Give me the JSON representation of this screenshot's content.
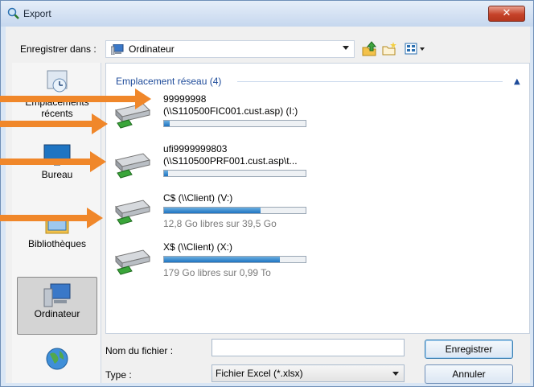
{
  "window": {
    "title": "Export",
    "close_label": "✕"
  },
  "toolbar": {
    "save_in_label": "Enregistrer dans :",
    "location_value": "Ordinateur",
    "buttons": [
      "up-folder-icon",
      "new-folder-icon",
      "view-menu-icon"
    ]
  },
  "places": [
    {
      "label": "Emplacements récents",
      "icon": "recent-places-icon"
    },
    {
      "label": "Bureau",
      "icon": "desktop-icon"
    },
    {
      "label": "Bibliothèques",
      "icon": "libraries-icon"
    },
    {
      "label": "Ordinateur",
      "icon": "computer-icon",
      "selected": true
    },
    {
      "label": "",
      "icon": "network-icon"
    }
  ],
  "file_list": {
    "group_header": "Emplacement réseau (4)",
    "drives": [
      {
        "name": "99999998",
        "path": "(\\\\S110500FIC001.cust.asp) (I:)",
        "used_fraction": 0.04,
        "free_text": ""
      },
      {
        "name": "ufi9999999803",
        "path": "(\\\\S110500PRF001.cust.asp\\t...",
        "used_fraction": 0.03,
        "free_text": ""
      },
      {
        "name": "C$ (\\\\Client) (V:)",
        "path": "",
        "used_fraction": 0.68,
        "free_text": "12,8 Go libres sur 39,5 Go"
      },
      {
        "name": "X$ (\\\\Client) (X:)",
        "path": "",
        "used_fraction": 0.82,
        "free_text": "179 Go libres sur 0,99 To"
      }
    ]
  },
  "form": {
    "filename_label": "Nom du fichier :",
    "filename_value": "",
    "type_label": "Type :",
    "type_value": "Fichier Excel (*.xlsx)",
    "save_button": "Enregistrer",
    "cancel_button": "Annuler"
  },
  "colors": {
    "accent": "#1e74c2",
    "arrow": "#f0872a",
    "group_header": "#1e4b9a"
  }
}
